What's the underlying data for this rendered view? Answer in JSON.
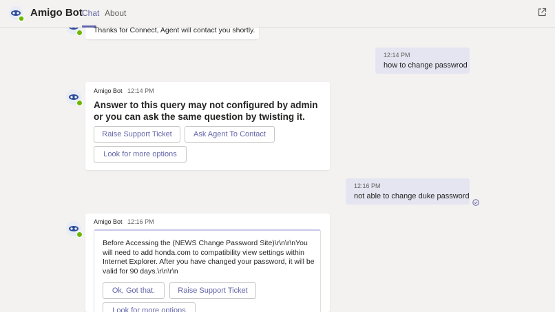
{
  "header": {
    "app_title": "Amigo Bot",
    "tabs": [
      {
        "label": "Chat",
        "active": true
      },
      {
        "label": "About",
        "active": false
      }
    ]
  },
  "colors": {
    "accent": "#6264a7",
    "outgoing_bubble": "#e5e5f1",
    "status_available": "#6bb700",
    "background": "#f3f2f1"
  },
  "messages": {
    "m0": {
      "text": "Thanks for Connect, Agent will contact you shortly."
    },
    "m1": {
      "time": "12:14 PM",
      "text": "how to change passwrod"
    },
    "m2": {
      "sender": "Amigo Bot",
      "time": "12:14 PM",
      "text": "Answer to this query may not configured by admin or you can ask the same question by twisting it.",
      "buttons": [
        "Raise Support Ticket",
        "Ask Agent To Contact",
        "Look for more options"
      ]
    },
    "m3": {
      "time": "12:16 PM",
      "text": "not able to change duke password"
    },
    "m4": {
      "sender": "Amigo Bot",
      "time": "12:16 PM",
      "text": "Before Accessing the (NEWS Change Password Site)\\r\\n\\r\\nYou will need to add honda.com to compatibility view settings within Internet Explorer. After you have changed your password, it will be valid for 90 days.\\r\\n\\r\\n",
      "buttons": [
        "Ok, Got that.",
        "Raise Support Ticket",
        "Look for more options"
      ]
    }
  }
}
